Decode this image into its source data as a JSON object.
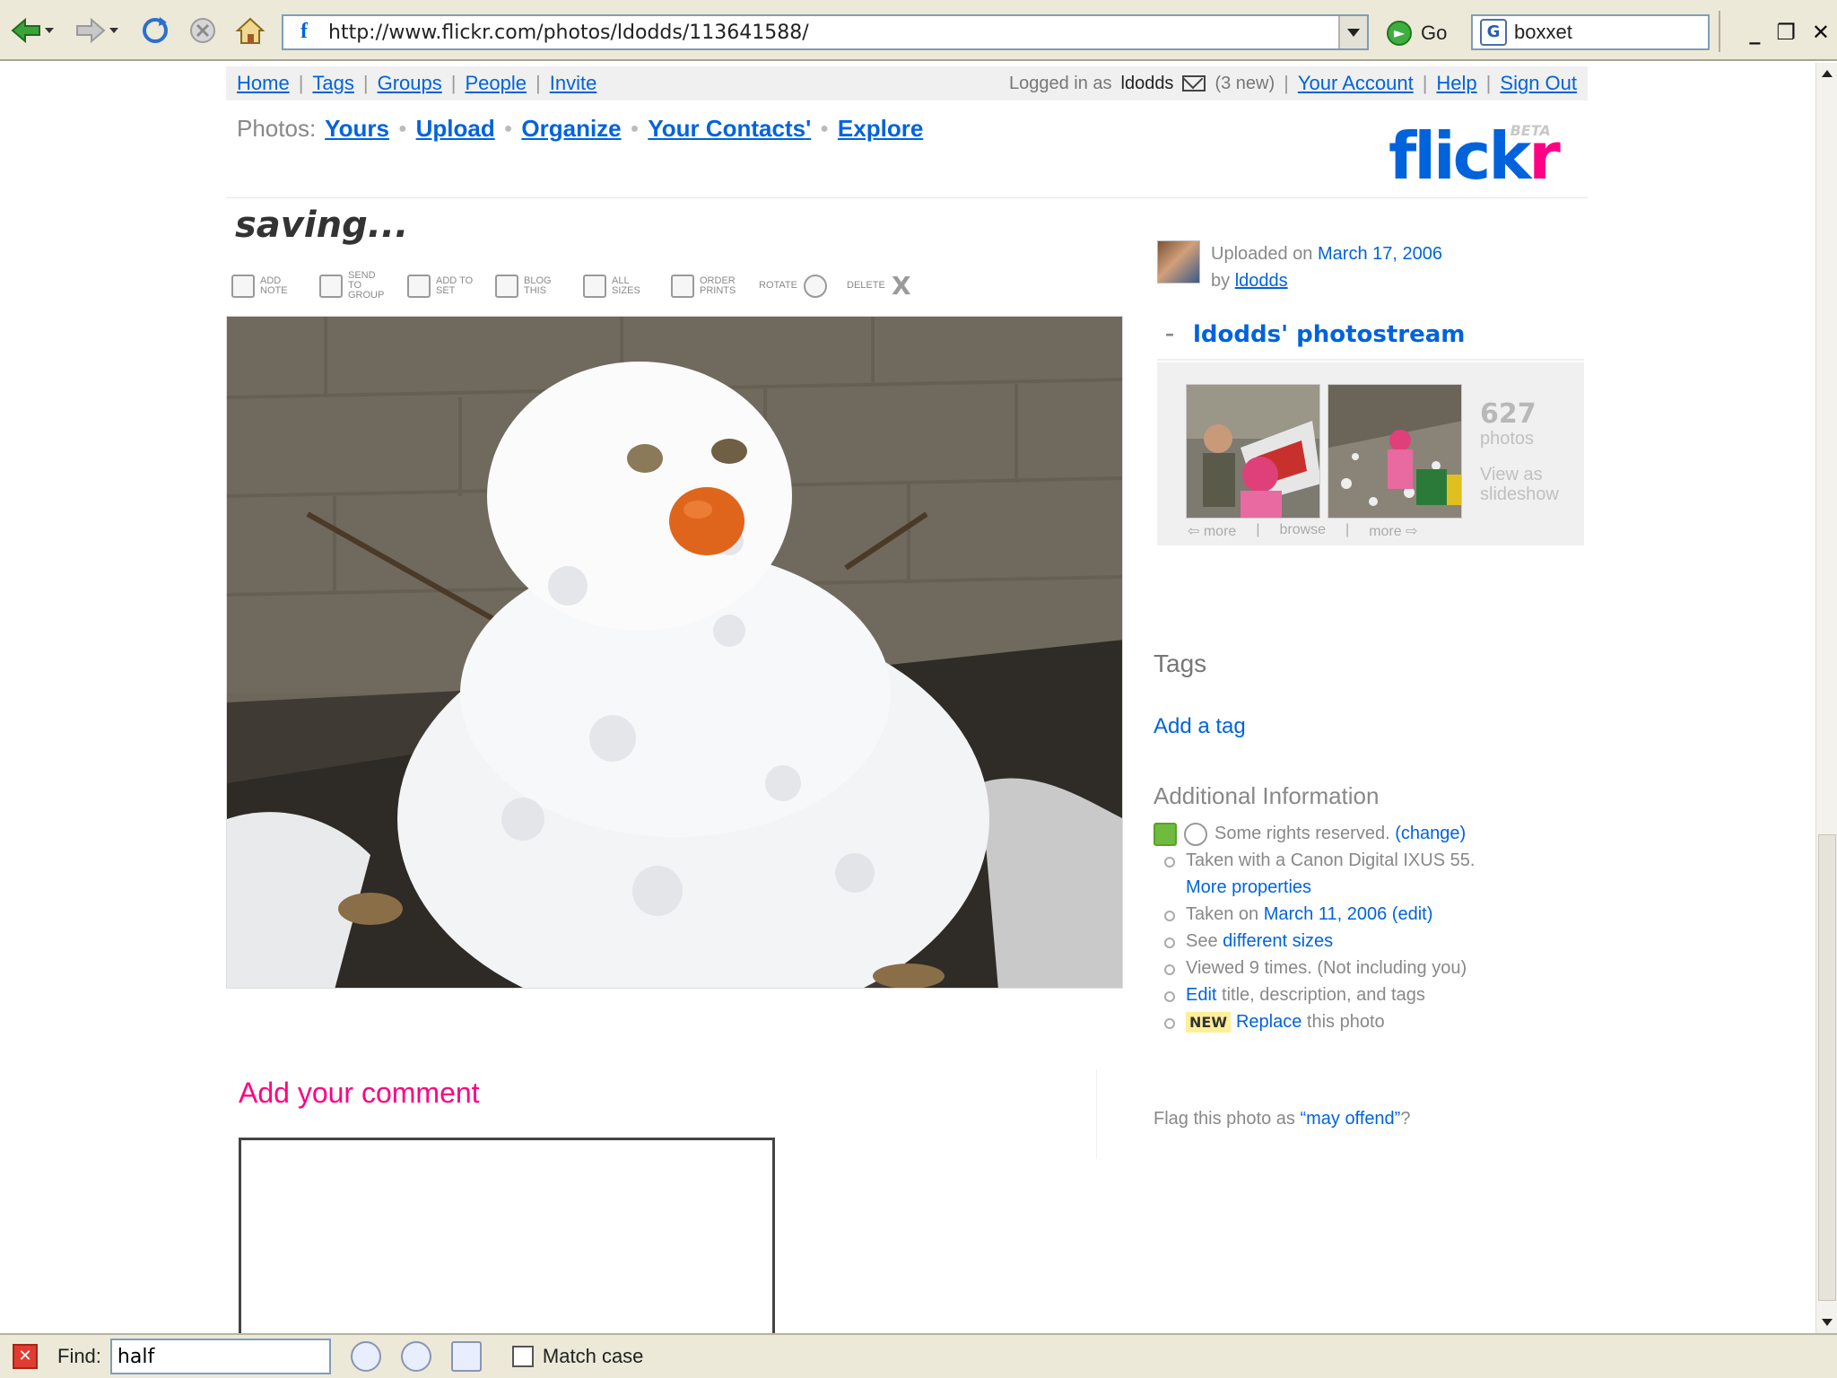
{
  "browser": {
    "url": "http://www.flickr.com/photos/ldodds/113641588/",
    "go_label": "Go",
    "search_value": "boxxet",
    "window_controls": [
      "_",
      "❐",
      "✕"
    ]
  },
  "topnav": {
    "links": [
      "Home",
      "Tags",
      "Groups",
      "People",
      "Invite"
    ],
    "logged_in_prefix": "Logged in as",
    "username": "ldodds",
    "new_count": "(3 new)",
    "account_links": [
      "Your Account",
      "Help",
      "Sign Out"
    ]
  },
  "photosnav": {
    "prefix": "Photos:",
    "links": [
      "Yours",
      "Upload",
      "Organize",
      "Your Contacts'",
      "Explore"
    ]
  },
  "logo": {
    "main": "flick",
    "accent": "r",
    "badge": "BETA"
  },
  "photo": {
    "title": "saving...",
    "actions": [
      {
        "icon": "add-note-icon",
        "label": "ADD NOTE"
      },
      {
        "icon": "send-to-group-icon",
        "label": "SEND TO GROUP"
      },
      {
        "icon": "add-to-set-icon",
        "label": "ADD TO SET"
      },
      {
        "icon": "blog-this-icon",
        "label": "BLOG THIS"
      },
      {
        "icon": "all-sizes-icon",
        "label": "ALL SIZES"
      },
      {
        "icon": "order-prints-icon",
        "label": "ORDER PRINTS"
      },
      {
        "icon": "rotate-icon",
        "label": "ROTATE"
      },
      {
        "icon": "delete-icon",
        "label": "DELETE"
      }
    ]
  },
  "comment": {
    "heading": "Add your comment",
    "value": ""
  },
  "uploader": {
    "uploaded_prefix": "Uploaded on",
    "date": "March 17, 2006",
    "by_prefix": "by",
    "user": "ldodds"
  },
  "photostream": {
    "toggle": "–",
    "title": "ldodds' photostream",
    "count": "627",
    "count_label": "photos",
    "slideshow": "View as slideshow",
    "nav": [
      "⇦ more",
      "browse",
      "more ⇨"
    ]
  },
  "tags": {
    "heading": "Tags",
    "add_link": "Add a tag"
  },
  "info": {
    "heading": "Additional Information",
    "license_text": "Some rights reserved.",
    "license_link": "(change)",
    "taken_with": "Taken with a Canon Digital IXUS 55.",
    "more_props": "More properties",
    "taken_on_prefix": "Taken on",
    "taken_on_date": "March 11, 2006",
    "taken_on_edit": "(edit)",
    "see_prefix": "See",
    "see_link": "different sizes",
    "viewed": "Viewed 9 times. (Not including you)",
    "edit_link": "Edit",
    "edit_suffix": "title, description, and tags",
    "new_badge": "NEW",
    "replace_link": "Replace",
    "replace_suffix": "this photo"
  },
  "flag": {
    "prefix": "Flag this photo as",
    "link": "“may offend”",
    "suffix": "?"
  },
  "findbar": {
    "label": "Find:",
    "value": "half",
    "match_case": "Match case"
  }
}
